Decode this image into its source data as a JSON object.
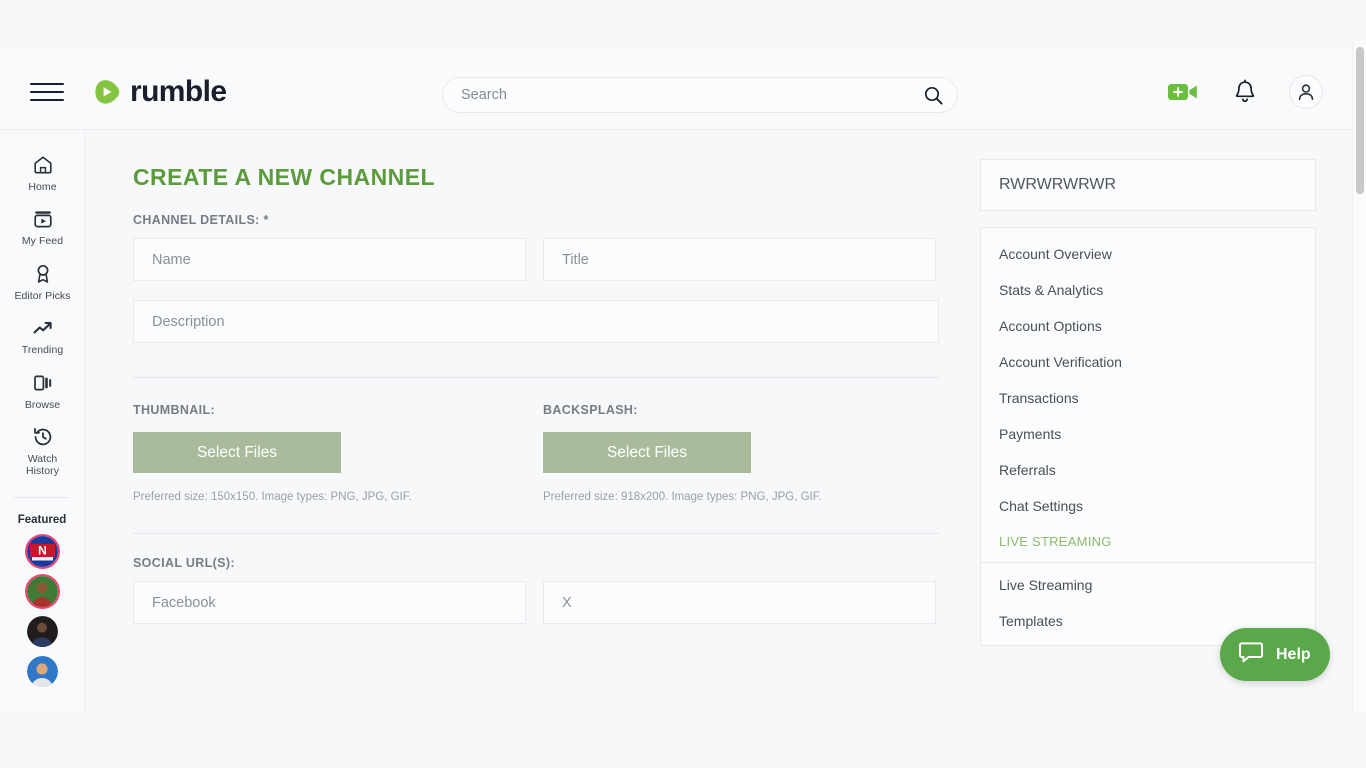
{
  "header": {
    "logo_text": "rumble",
    "menu_icon": "hamburger-menu-icon",
    "search": {
      "placeholder": "Search",
      "value": "",
      "icon": "search-icon"
    },
    "actions": [
      {
        "name": "upload-video-icon",
        "label": ""
      },
      {
        "name": "notifications-bell-icon",
        "label": ""
      },
      {
        "name": "account-user-icon",
        "label": ""
      }
    ],
    "accent_green": "#85c440"
  },
  "left_rail": {
    "items": [
      {
        "label": "Home",
        "icon": "home-icon"
      },
      {
        "label": "My Feed",
        "icon": "my-feed-icon"
      },
      {
        "label": "Editor Picks",
        "icon": "editor-picks-ribbon-icon"
      },
      {
        "label": "Trending",
        "icon": "trending-arrow-icon"
      },
      {
        "label": "Browse",
        "icon": "browse-icon"
      },
      {
        "label": "Watch\nHistory",
        "icon": "watch-history-clock-icon"
      }
    ],
    "featured_label": "Featured",
    "featured_avatars": [
      {
        "name": "featured-avatar-1"
      },
      {
        "name": "featured-avatar-2"
      },
      {
        "name": "featured-avatar-3"
      },
      {
        "name": "featured-avatar-4"
      }
    ]
  },
  "main": {
    "page_title": "CREATE A NEW CHANNEL",
    "title_color": "#5c9b3c",
    "channel_details_label": "CHANNEL DETAILS: *",
    "fields": {
      "name_placeholder": "Name",
      "name_value": "",
      "title_placeholder": "Title",
      "title_value": "",
      "description_placeholder": "Description",
      "description_value": ""
    },
    "thumbnail": {
      "label": "THUMBNAIL:",
      "button_label": "Select Files",
      "hint": "Preferred size: 150x150. Image types: PNG, JPG, GIF."
    },
    "backsplash": {
      "label": "BACKSPLASH:",
      "button_label": "Select Files",
      "hint": "Preferred size: 918x200. Image types: PNG, JPG, GIF."
    },
    "social": {
      "label": "SOCIAL URL(S):",
      "facebook_placeholder": "Facebook",
      "facebook_value": "",
      "x_placeholder": "X",
      "x_value": ""
    },
    "button_color": "#a9bb9b"
  },
  "right_panel": {
    "channel_name": "RWRWRWRWR",
    "menu": [
      {
        "label": "Account Overview",
        "type": "item"
      },
      {
        "label": "Stats & Analytics",
        "type": "item"
      },
      {
        "label": "Account Options",
        "type": "item"
      },
      {
        "label": "Account Verification",
        "type": "item"
      },
      {
        "label": "Transactions",
        "type": "item"
      },
      {
        "label": "Payments",
        "type": "item"
      },
      {
        "label": "Referrals",
        "type": "item"
      },
      {
        "label": "Chat Settings",
        "type": "item"
      },
      {
        "label": "LIVE STREAMING",
        "type": "group"
      },
      {
        "label": "Live Streaming",
        "type": "item"
      },
      {
        "label": "Templates",
        "type": "item"
      }
    ],
    "group_color": "#8cbb6d"
  },
  "help_widget": {
    "label": "Help",
    "icon": "chat-bubble-icon",
    "color": "#5aa84a"
  }
}
